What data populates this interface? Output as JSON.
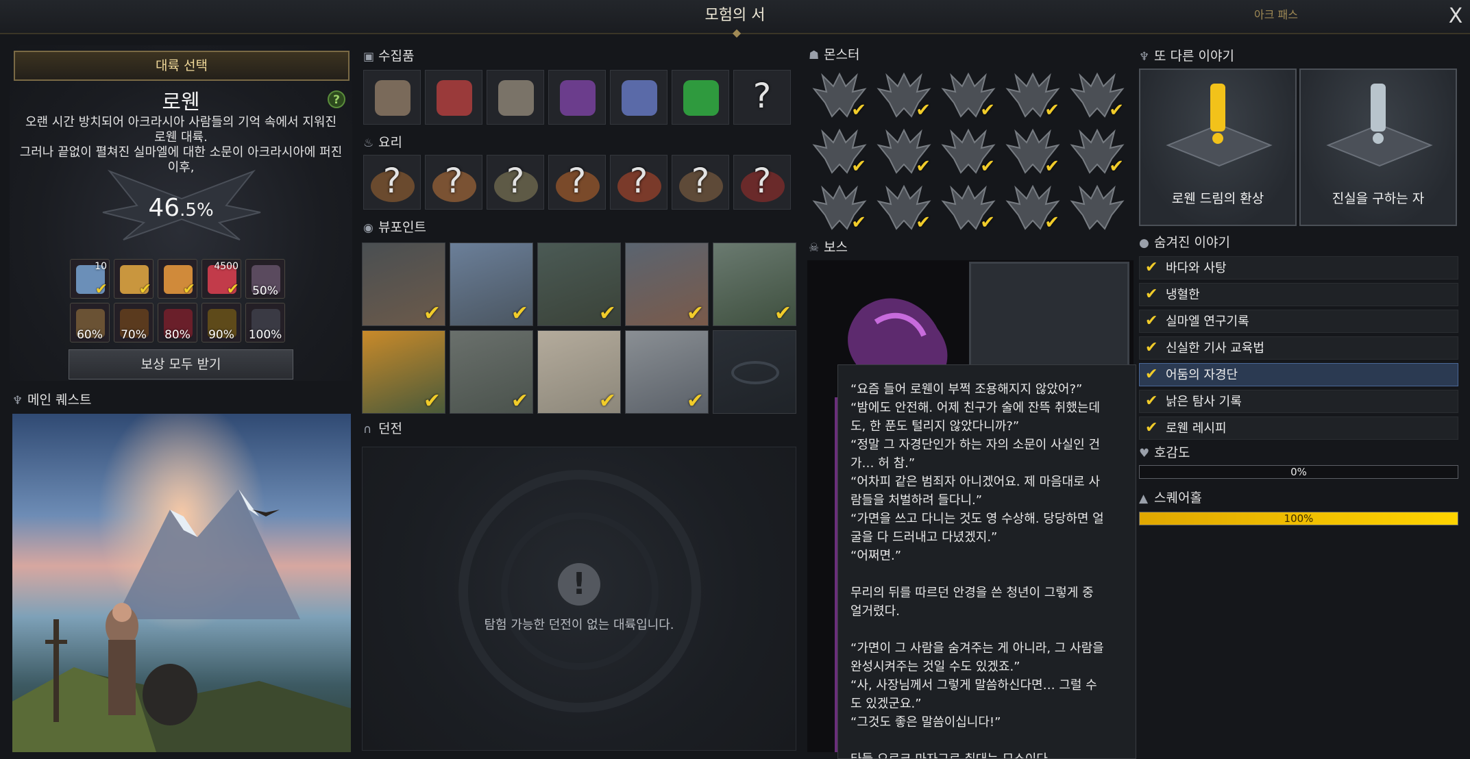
{
  "window": {
    "title": "모험의 서",
    "top_right_label": "아크 패스",
    "close_glyph": "X"
  },
  "continent": {
    "select_label": "대륙 선택",
    "name": "로웬",
    "help_glyph": "?",
    "description_lines": [
      "오랜 시간 방치되어 아크라시아 사람들의 기억 속에서 지워진",
      "로웬 대륙.",
      "그러나 끝없이 펼쳐진 실마엘에 대한 소문이 아크라시아에 퍼진",
      "이후,"
    ],
    "progress_whole": "46",
    "progress_fraction": ".5%"
  },
  "rewards": [
    {
      "qty": "10",
      "pct": "",
      "checked": true,
      "color": "#6b8fb8"
    },
    {
      "qty": "",
      "pct": "",
      "checked": true,
      "color": "#c9963e"
    },
    {
      "qty": "",
      "pct": "",
      "checked": true,
      "color": "#d08a3a"
    },
    {
      "qty": "4500",
      "pct": "",
      "checked": true,
      "color": "#c23b4a"
    },
    {
      "qty": "",
      "pct": "50%",
      "checked": false,
      "color": "#5a4a5e"
    },
    {
      "qty": "",
      "pct": "60%",
      "checked": false,
      "color": "#6a5234"
    },
    {
      "qty": "",
      "pct": "70%",
      "checked": false,
      "color": "#5a3a1e"
    },
    {
      "qty": "",
      "pct": "80%",
      "checked": false,
      "color": "#6a1f2a"
    },
    {
      "qty": "",
      "pct": "90%",
      "checked": false,
      "color": "#5e4a1a"
    },
    {
      "qty": "",
      "pct": "100%",
      "checked": false,
      "color": "#3a3a44"
    }
  ],
  "claim_all_label": "보상 모두 받기",
  "sections": {
    "main_quest": "메인 퀘스트",
    "collectibles": "수집품",
    "cooking": "요리",
    "vistas": "뷰포인트",
    "dungeon": "던전",
    "monsters": "몬스터",
    "boss": "보스",
    "another_story": "또 다른 이야기",
    "hidden_story": "숨겨진 이야기",
    "affinity": "호감도",
    "square_hole": "스퀘어홀"
  },
  "collectibles": [
    {
      "icon": "map-icon",
      "color": "#7a6a5a",
      "checked": false,
      "unknown": false
    },
    {
      "icon": "insect-icon",
      "color": "#9a3a3a",
      "checked": false,
      "unknown": false
    },
    {
      "icon": "coin-icon",
      "color": "#7a7368",
      "checked": false,
      "unknown": false
    },
    {
      "icon": "book-icon",
      "color": "#6b3d8c",
      "checked": false,
      "unknown": false
    },
    {
      "icon": "crystal-icon",
      "color": "#5a6aa8",
      "checked": false,
      "unknown": false
    },
    {
      "icon": "seed-icon",
      "color": "#2f9a3e",
      "checked": false,
      "unknown": false
    },
    {
      "icon": "unknown-icon",
      "color": "#3a2f28",
      "checked": false,
      "unknown": true
    }
  ],
  "cooking": [
    {
      "color": "#6a4a2e"
    },
    {
      "color": "#7a5233"
    },
    {
      "color": "#5e5a46"
    },
    {
      "color": "#7a4a2a"
    },
    {
      "color": "#7a3a2a"
    },
    {
      "color": "#5e4a38"
    },
    {
      "color": "#6a2a2a"
    }
  ],
  "vistas": [
    {
      "colors": [
        "#4a4f52",
        "#6c5a4a"
      ],
      "checked": true
    },
    {
      "colors": [
        "#6b7f99",
        "#4a5560"
      ],
      "checked": true
    },
    {
      "colors": [
        "#4b5a55",
        "#3a4238"
      ],
      "checked": true
    },
    {
      "colors": [
        "#5a6470",
        "#7a5a4a"
      ],
      "checked": true
    },
    {
      "colors": [
        "#6a7a70",
        "#3e4f3e"
      ],
      "checked": true
    },
    {
      "colors": [
        "#c98a2a",
        "#4a5a3a"
      ],
      "checked": true
    },
    {
      "colors": [
        "#6a706c",
        "#4a524c"
      ],
      "checked": true
    },
    {
      "colors": [
        "#b4ab9c",
        "#8c877a"
      ],
      "checked": true
    },
    {
      "colors": [
        "#8a8f94",
        "#5a6068"
      ],
      "checked": true
    },
    {
      "colors": [
        "#2a2f36",
        "#1f2328"
      ],
      "checked": false,
      "locked": true
    }
  ],
  "dungeon_empty_text": "탐험 가능한 던전이 없는 대륙입니다.",
  "monsters": [
    true,
    true,
    true,
    true,
    true,
    true,
    true,
    true,
    true,
    true,
    true,
    true,
    true,
    true,
    false
  ],
  "tooltip_lines": [
    "“요즘 들어 로웬이 부쩍 조용해지지 않았어?”",
    "“밤에도 안전해. 어제 친구가 술에 잔뜩 취했는데",
    "도, 한 푼도 털리지 않았다니까?”",
    "“정말 그 자경단인가 하는 자의 소문이 사실인 건",
    "가… 허 참.”",
    "“어차피 같은 범죄자 아니겠어요. 제 마음대로 사",
    "람들을 처벌하려 들다니.”",
    "“가면을 쓰고 다니는 것도 영 수상해. 당당하면 얼",
    "굴을 다 드러내고 다녔겠지.”",
    "“어쩌면.”",
    "",
    "무리의 뒤를 따르던 안경을 쓴 청년이 그렇게 중",
    "얼거렸다.",
    "",
    "“가면이 그 사람을 숨겨주는 게 아니라, 그 사람을",
    "완성시켜주는 것일 수도 있겠죠.”",
    "“사, 사장님께서 그렇게 말씀하신다면… 그럴 수",
    "도 있겠군요.”",
    "“그것도 좋은 말씀이십니다!”",
    "",
    "타들 으로크 마자그로 취대는 모소이다"
  ],
  "another_stories": [
    {
      "label": "로웬 드림의 환상",
      "icon": "exclamation-gold"
    },
    {
      "label": "진실을 구하는 자",
      "icon": "exclamation-silver"
    }
  ],
  "hidden_stories": [
    {
      "label": "바다와 사탕",
      "checked": true,
      "selected": false
    },
    {
      "label": "냉혈한",
      "checked": true,
      "selected": false
    },
    {
      "label": "실마엘 연구기록",
      "checked": true,
      "selected": false
    },
    {
      "label": "신실한 기사 교육법",
      "checked": true,
      "selected": false
    },
    {
      "label": "어둠의 자경단",
      "checked": true,
      "selected": true
    },
    {
      "label": "낡은 탐사 기록",
      "checked": true,
      "selected": false
    },
    {
      "label": "로웬 레시피",
      "checked": true,
      "selected": false
    }
  ],
  "affinity": {
    "value_text": "0%",
    "fraction": 0
  },
  "square_hole": {
    "value_text": "100%",
    "fraction": 1.0
  },
  "colors": {
    "check": "#f1cc2a",
    "accent_gold": "#f0d99a",
    "selected_row": "#2b3a52"
  }
}
